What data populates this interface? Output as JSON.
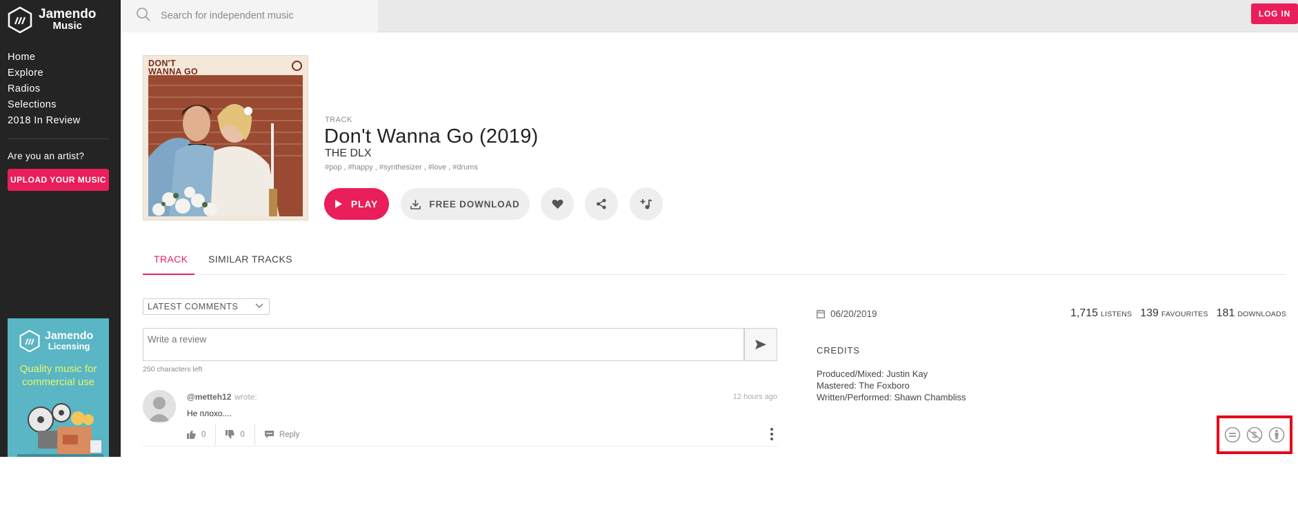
{
  "app": {
    "brand_line1": "Jamendo",
    "brand_line2": "Music"
  },
  "sidebar": {
    "items": [
      {
        "label": "Home"
      },
      {
        "label": "Explore"
      },
      {
        "label": "Radios"
      },
      {
        "label": "Selections"
      },
      {
        "label": "2018 In Review"
      }
    ],
    "artist_question": "Are you an artist?",
    "upload_label": "UPLOAD YOUR MUSIC",
    "promo": {
      "brand_line1": "Jamendo",
      "brand_line2": "Licensing",
      "tagline": "Quality music for commercial use"
    }
  },
  "header": {
    "search_placeholder": "Search for independent music",
    "login_label": "LOG IN"
  },
  "track": {
    "cover_text": "DON'T\nWANNA GO",
    "type": "TRACK",
    "title": "Don't Wanna Go (2019)",
    "artist": "THE DLX",
    "tags": "#pop , #happy , #synthesizer , #love , #drums",
    "play_label": "PLAY",
    "download_label": "FREE DOWNLOAD"
  },
  "tabs": [
    {
      "label": "TRACK",
      "active": true
    },
    {
      "label": "SIMILAR TRACKS",
      "active": false
    }
  ],
  "comments": {
    "sort_value": "LATEST COMMENTS",
    "review_placeholder": "Write a review",
    "chars_left": "250 characters left",
    "items": [
      {
        "user": "@metteh12",
        "wrote": "wrote:",
        "time": "12 hours ago",
        "text": "Не плохо....",
        "likes": "0",
        "dislikes": "0",
        "reply_label": "Reply"
      }
    ]
  },
  "details": {
    "date": "06/20/2019",
    "listens_value": "1,715",
    "listens_label": "LISTENS",
    "favourites_value": "139",
    "favourites_label": "FAVOURITES",
    "downloads_value": "181",
    "downloads_label": "DOWNLOADS",
    "credits_heading": "CREDITS",
    "credits": [
      "Produced/Mixed: Justin Kay",
      "Mastered: The Foxboro",
      "Written/Performed: Shawn Chambliss"
    ],
    "license_icons": [
      "no-derivatives-icon",
      "non-commercial-icon",
      "attribution-icon"
    ]
  },
  "colors": {
    "accent": "#e91e5a",
    "sidebar_bg": "#242424",
    "promo_bg": "#5ab5c4",
    "highlight_box": "#e50019"
  }
}
